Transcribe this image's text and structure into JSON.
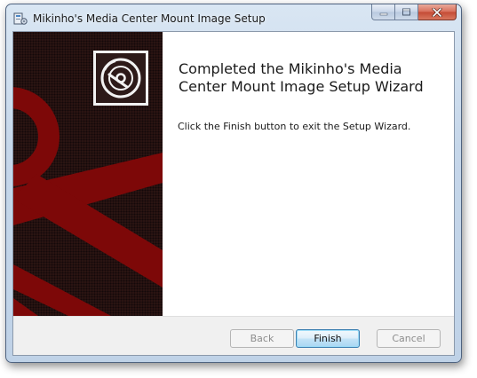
{
  "window": {
    "title": "Mikinho's Media Center Mount Image Setup",
    "icons": {
      "app": "installer-icon",
      "minimize": "minimize-icon",
      "maximize": "maximize-icon",
      "close": "close-icon"
    }
  },
  "banner": {
    "image": "anchor-banner",
    "logo": "disc-icon",
    "colors": {
      "dark": "#2b1413",
      "anchor": "#7d0808"
    }
  },
  "main": {
    "heading": "Completed the Mikinho's Media Center Mount Image Setup Wizard",
    "body": "Click the Finish button to exit the Setup Wizard."
  },
  "footer": {
    "back_label": "Back",
    "finish_label": "Finish",
    "cancel_label": "Cancel"
  }
}
